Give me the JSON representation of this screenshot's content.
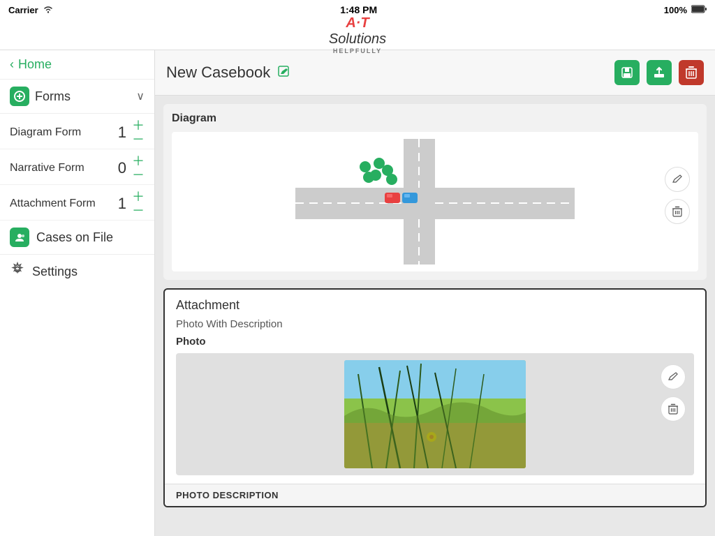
{
  "statusBar": {
    "carrier": "Carrier",
    "time": "1:48 PM",
    "battery": "100%"
  },
  "header": {
    "logo_main": "A-T",
    "logo_sub": "Solutions",
    "tagline": "HELPFULLY"
  },
  "sidebar": {
    "home_label": "Home",
    "forms_label": "Forms",
    "forms_items": [
      {
        "label": "Diagram Form",
        "count": "1"
      },
      {
        "label": "Narrative Form",
        "count": "0"
      },
      {
        "label": "Attachment Form",
        "count": "1"
      }
    ],
    "cases_label": "Cases on File",
    "settings_label": "Settings"
  },
  "main": {
    "casebook_title": "New Casebook",
    "diagram_section": "Diagram",
    "attachment_section": "Attachment",
    "attachment_type": "Photo With Description",
    "photo_label": "Photo",
    "photo_desc_label": "PHOTO DESCRIPTION"
  },
  "actions": {
    "save_label": "💾",
    "export_label": "⬆",
    "delete_label": "🗑"
  }
}
